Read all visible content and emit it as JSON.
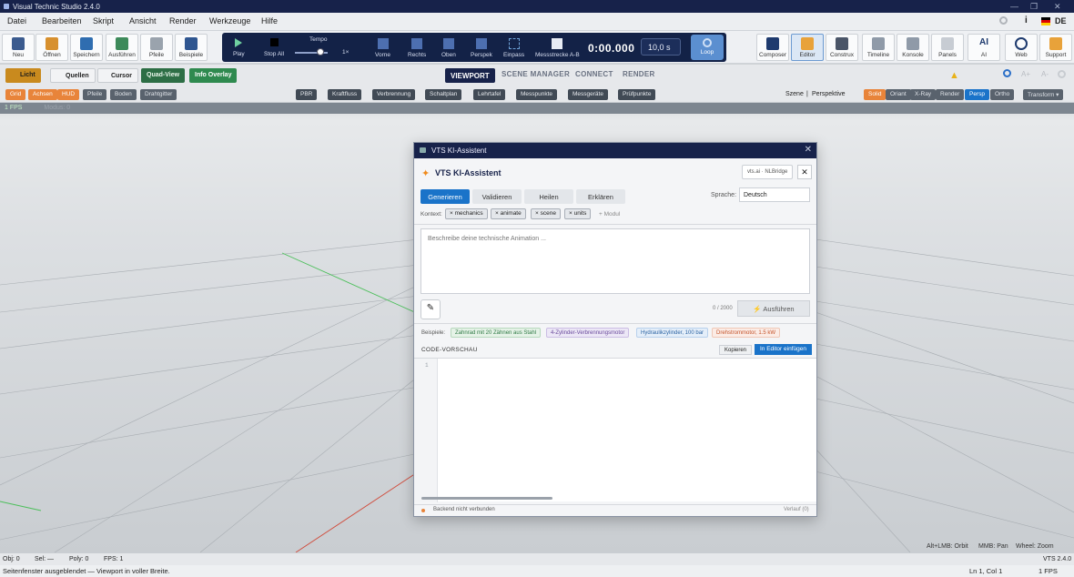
{
  "app": {
    "title": "Visual Technic Studio 2.4.0",
    "lang": "DE"
  },
  "window": {
    "minimize": "—",
    "maximize": "❐",
    "close": "✕"
  },
  "menu": [
    "Datei",
    "Bearbeiten",
    "Skript",
    "Ansicht",
    "Render",
    "Werkzeuge",
    "Hilfe"
  ],
  "toolbar": {
    "file_tools": [
      "Neu",
      "Öffnen",
      "Speichern",
      "Ausführen",
      "Pfeile",
      "Beispiele"
    ],
    "transport": {
      "play": "Play",
      "stop_all": "Stop All",
      "tempo_label": "Tempo",
      "speed": "1×",
      "views": [
        "Vorne",
        "Rechts",
        "Oben",
        "Perspek",
        "Einpass",
        "Messstrecke A-B"
      ],
      "timecode": "0:00.000",
      "duration": "10,0 s",
      "loop": "Loop"
    },
    "panels": [
      "Composer",
      "Editor",
      "Construx",
      "Timeline",
      "Konsole",
      "Panels",
      "AI",
      "Web",
      "Support"
    ]
  },
  "row3": {
    "licht": "Licht",
    "quellen": "Quellen",
    "cursor": "Cursor",
    "quad_view": "Quad-View",
    "info_overlay": "Info Overlay",
    "tabs": [
      "VIEWPORT",
      "SCENE MANAGER",
      "CONNECT",
      "RENDER"
    ]
  },
  "row4": {
    "left_chips": [
      "Grid",
      "Achsen",
      "HUD",
      "Pfeile",
      "Boden",
      "Drahtgitter"
    ],
    "mid_chips": [
      "PBR",
      "Kraftfluss",
      "Verbrennung",
      "Schaltplan",
      "Lehrtafel",
      "Messpunkte",
      "Messgeräte",
      "Prüfpunkte"
    ],
    "scene_label": "Szene",
    "sep": "|",
    "perspective_label": "Perspektive",
    "render_modes": [
      "Solid",
      "Oriant",
      "X-Ray",
      "Render",
      "Persp",
      "Ortho"
    ],
    "transform": "Transform ▾"
  },
  "viewport": {
    "fps": "1 FPS",
    "mode": "Modus: 0"
  },
  "dialog": {
    "window_title": "VTS KI-Assistent",
    "heading": "VTS KI-Assistent",
    "provider": "vts.ai · NLBridge",
    "modes": [
      "Generieren",
      "Validieren",
      "Heilen",
      "Erklären"
    ],
    "language_label": "Sprache:",
    "language_value": "Deutsch",
    "context_label": "Kontext:",
    "context_tags": [
      "× mechanics",
      "× animate",
      "× scene",
      "× units"
    ],
    "add_module": "+ Modul",
    "prompt_placeholder": "Beschreibe deine technische Animation ...",
    "char_count": "0 / 2000",
    "run": "Ausführen",
    "examples_label": "Beispiele:",
    "examples": [
      "Zahnrad mit 20 Zähnen aus Stahl",
      "4-Zylinder-Verbrennungsmotor",
      "Hydraulikzylinder, 100 bar",
      "Drehstrommotor, 1.5 kW"
    ],
    "code_preview": "CODE-VORSCHAU",
    "copy": "Kopieren",
    "insert": "In Editor einfügen",
    "line_number": "1",
    "backend_status": "Backend nicht verbunden",
    "history": "Verlauf (0)"
  },
  "status": {
    "obj": "Obj: 0",
    "sel": "Sel: —",
    "poly": "Poly: 0",
    "fps": "FPS: 1",
    "hint_orbit": "Alt+LMB: Orbit",
    "hint_pan": "MMB: Pan",
    "hint_zoom": "Wheel: Zoom",
    "version": "VTS 2.4.0"
  },
  "bottom": {
    "message": "Seitenfenster ausgeblendet — Viewport in voller Breite.",
    "cursor_pos": "Ln 1, Col 1",
    "fps": "1 FPS"
  },
  "colors": {
    "navy": "#17224a",
    "accent_blue": "#1a73c9",
    "orange": "#e8843a",
    "green": "#2f8a4f"
  }
}
